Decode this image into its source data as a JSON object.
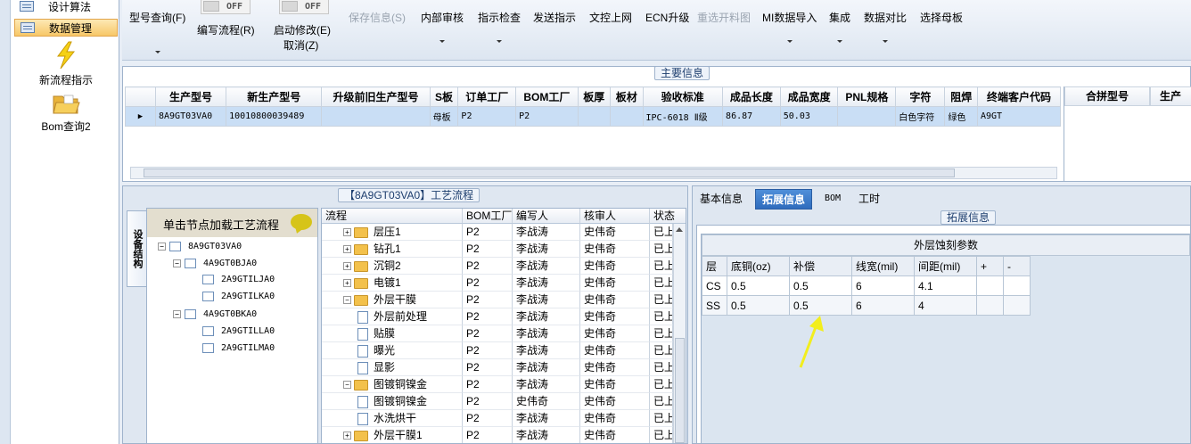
{
  "sidebar": {
    "items": [
      {
        "label": "设计算法",
        "selected": false
      },
      {
        "label": "数据管理",
        "selected": true
      }
    ],
    "big_items": [
      {
        "label": "新流程指示",
        "icon": "lightning-icon"
      },
      {
        "label": "Bom查询2",
        "icon": "folder-open-icon"
      }
    ]
  },
  "toolbar": {
    "model_query": "型号查询(F)",
    "write_flow": "编写流程(R)",
    "write_flow_toggle": "OFF",
    "start_modify": "启动修改(E)",
    "start_modify_toggle": "OFF",
    "cancel": "取消(Z)",
    "save_info": "保存信息(S)",
    "internal_review": "内部审核",
    "indicator_check": "指示检查",
    "send_indicator": "发送指示",
    "doc_upload": "文控上网",
    "ecn_upgrade": "ECN升级",
    "rebuild_material": "重选开料图",
    "mi_import": "MI数据导入",
    "integrate": "集成",
    "data_compare": "数据对比",
    "select_mother": "选择母板"
  },
  "main_info": {
    "title": "主要信息",
    "columns": [
      "生产型号",
      "新生产型号",
      "升级前旧生产型号",
      "S板",
      "订单工厂",
      "BOM工厂",
      "板厚",
      "板材",
      "验收标准",
      "成品长度",
      "成品宽度",
      "PNL规格",
      "字符",
      "阻焊",
      "终端客户代码"
    ],
    "rows": [
      [
        "8A9GT03VA0",
        "10010800039489",
        "",
        "母板",
        "P2",
        "P2",
        "",
        "",
        "IPC-6018 Ⅱ级",
        "86.87",
        "50.03",
        "",
        "白色字符",
        "绿色",
        "A9GT"
      ]
    ],
    "side_columns": [
      "合拼型号",
      "生产"
    ]
  },
  "flow_panel": {
    "title": "【8A9GT03VA0】工艺流程",
    "vertical_tab": "设备结构",
    "tree_header": "单击节点加载工艺流程",
    "tree": [
      {
        "label": "8A9GT03VA0",
        "level": 0
      },
      {
        "label": "4A9GT0BJA0",
        "level": 1
      },
      {
        "label": "2A9GTILJA0",
        "level": 2
      },
      {
        "label": "2A9GTILKA0",
        "level": 2
      },
      {
        "label": "4A9GT0BKA0",
        "level": 1
      },
      {
        "label": "2A9GTILLA0",
        "level": 2
      },
      {
        "label": "2A9GTILMA0",
        "level": 2
      }
    ],
    "columns": [
      "流程",
      "BOM工厂",
      "编写人",
      "核审人",
      "状态"
    ],
    "rows": [
      {
        "name": "层压1",
        "type": "folder",
        "expand": "+",
        "bom": "P2",
        "writer": "李战涛",
        "reviewer": "史伟奇",
        "status": "已上"
      },
      {
        "name": "钻孔1",
        "type": "folder",
        "expand": "+",
        "bom": "P2",
        "writer": "李战涛",
        "reviewer": "史伟奇",
        "status": "已上"
      },
      {
        "name": "沉铜2",
        "type": "folder",
        "expand": "+",
        "bom": "P2",
        "writer": "李战涛",
        "reviewer": "史伟奇",
        "status": "已上"
      },
      {
        "name": "电镀1",
        "type": "folder",
        "expand": "+",
        "bom": "P2",
        "writer": "李战涛",
        "reviewer": "史伟奇",
        "status": "已上"
      },
      {
        "name": "外层干膜",
        "type": "folder",
        "expand": "-",
        "bom": "P2",
        "writer": "李战涛",
        "reviewer": "史伟奇",
        "status": "已上"
      },
      {
        "name": "外层前处理",
        "type": "doc",
        "expand": "",
        "bom": "P2",
        "writer": "李战涛",
        "reviewer": "史伟奇",
        "status": "已上"
      },
      {
        "name": "贴膜",
        "type": "doc",
        "expand": "",
        "bom": "P2",
        "writer": "李战涛",
        "reviewer": "史伟奇",
        "status": "已上"
      },
      {
        "name": "曝光",
        "type": "doc",
        "expand": "",
        "bom": "P2",
        "writer": "李战涛",
        "reviewer": "史伟奇",
        "status": "已上"
      },
      {
        "name": "显影",
        "type": "doc",
        "expand": "",
        "bom": "P2",
        "writer": "李战涛",
        "reviewer": "史伟奇",
        "status": "已上"
      },
      {
        "name": "图镀铜镍金",
        "type": "folder",
        "expand": "-",
        "bom": "P2",
        "writer": "李战涛",
        "reviewer": "史伟奇",
        "status": "已上"
      },
      {
        "name": "图镀铜镍金",
        "type": "doc",
        "expand": "",
        "bom": "P2",
        "writer": "史伟奇",
        "reviewer": "史伟奇",
        "status": "已上"
      },
      {
        "name": "水洗烘干",
        "type": "doc",
        "expand": "",
        "bom": "P2",
        "writer": "李战涛",
        "reviewer": "史伟奇",
        "status": "已上"
      },
      {
        "name": "外层干膜1",
        "type": "folder",
        "expand": "+",
        "bom": "P2",
        "writer": "李战涛",
        "reviewer": "史伟奇",
        "status": "已上"
      }
    ]
  },
  "right_panel": {
    "tabs": [
      "基本信息",
      "拓展信息",
      "BOM",
      "工时"
    ],
    "selected_tab": 1,
    "section_title": "拓展信息",
    "ext_table": {
      "title": "外层蚀刻参数",
      "columns": [
        "层",
        "底铜(oz)",
        "补偿",
        "线宽(mil)",
        "间距(mil)",
        "+",
        "-"
      ],
      "rows": [
        [
          "CS",
          "0.5",
          "0.5",
          "6",
          "4.1",
          "",
          ""
        ],
        [
          "SS",
          "0.5",
          "0.5",
          "6",
          "4",
          "",
          ""
        ]
      ]
    }
  },
  "colors": {
    "accent": "#2f6cbd",
    "selection": "#c9def5",
    "annotation_arrow": "#f2ee1e"
  }
}
